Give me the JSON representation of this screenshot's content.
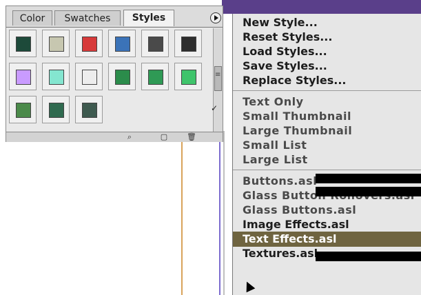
{
  "palette": {
    "tabs": [
      {
        "label": "Color"
      },
      {
        "label": "Swatches"
      },
      {
        "label": "Styles"
      }
    ],
    "styles": [
      {
        "name": "style-1",
        "color": "#1d4a3a"
      },
      {
        "name": "style-2",
        "color": "#c7c7b0"
      },
      {
        "name": "style-3",
        "color": "#d73a3a"
      },
      {
        "name": "style-4",
        "color": "#3b73b8"
      },
      {
        "name": "style-5",
        "color": "#4a4a4a"
      },
      {
        "name": "style-6",
        "color": "#2e2e2e"
      },
      {
        "name": "style-7",
        "color": "#c99bff"
      },
      {
        "name": "style-8",
        "color": "#84e6d0"
      },
      {
        "name": "style-9",
        "color": "#ededed"
      },
      {
        "name": "style-10",
        "color": "#2b8c4b"
      },
      {
        "name": "style-11",
        "color": "#2f9a55"
      },
      {
        "name": "style-12",
        "color": "#3fc46b"
      },
      {
        "name": "style-13",
        "color": "#4b8a4a"
      },
      {
        "name": "style-14",
        "color": "#2f6a4f"
      },
      {
        "name": "style-15",
        "color": "#3e5a4f"
      }
    ]
  },
  "menu": {
    "items": [
      {
        "label": "New Style...",
        "state": "enabled"
      },
      {
        "label": "Reset Styles...",
        "state": "enabled"
      },
      {
        "label": "Load Styles...",
        "state": "enabled"
      },
      {
        "label": "Save Styles...",
        "state": "enabled"
      },
      {
        "label": "Replace Styles...",
        "state": "enabled"
      },
      {
        "label": "Text Only",
        "state": "disabled"
      },
      {
        "label": "Small Thumbnail",
        "state": "disabled"
      },
      {
        "label": "Large Thumbnail",
        "state": "disabled"
      },
      {
        "label": "Small List",
        "state": "disabled"
      },
      {
        "label": "Large List",
        "state": "disabled"
      },
      {
        "label": "Buttons.asl",
        "state": "disabled"
      },
      {
        "label": "Glass Button Rollovers.asl",
        "state": "disabled"
      },
      {
        "label": "Glass Buttons.asl",
        "state": "disabled"
      },
      {
        "label": "Image Effects.asl",
        "state": "enabled"
      },
      {
        "label": "Text Effects.asl",
        "state": "highlighted"
      },
      {
        "label": "Textures.asl",
        "state": "enabled"
      }
    ]
  },
  "colors": {
    "highlight": "#6f6440",
    "menu_bg": "#e6e6e6",
    "palette_bg": "#e9e9e9",
    "purple_bg": "#5a3f8a"
  },
  "icons": {
    "panel_menu": "triangle-right-icon",
    "check": "check-icon",
    "search": "search-icon",
    "new": "new-item-icon",
    "trash": "trash-icon"
  }
}
